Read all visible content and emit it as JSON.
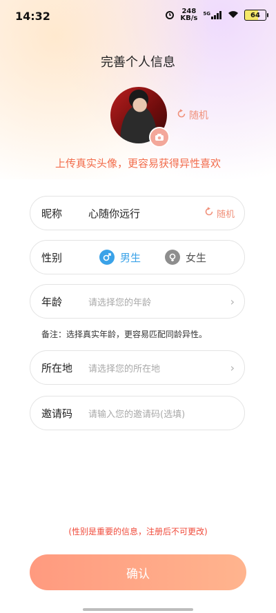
{
  "status_bar": {
    "time": "14:32",
    "net_speed_value": "248",
    "net_speed_unit": "KB/s",
    "network": "5G",
    "battery": "64"
  },
  "page": {
    "title": "完善个人信息",
    "random_label": "随机",
    "upload_tip": "上传真实头像，更容易获得异性喜欢"
  },
  "form": {
    "nickname": {
      "label": "昵称",
      "value": "心随你远行",
      "random_label": "随机"
    },
    "gender": {
      "label": "性别",
      "male": "男生",
      "female": "女生",
      "selected": "male"
    },
    "age": {
      "label": "年龄",
      "placeholder": "请选择您的年龄"
    },
    "age_note": "备注：选择真实年龄，更容易匹配同龄异性。",
    "location": {
      "label": "所在地",
      "placeholder": "请选择您的所在地"
    },
    "invite_code": {
      "label": "邀请码",
      "placeholder": "请输入您的邀请码(选填)"
    }
  },
  "footer": {
    "gender_note": "(性别是重要的信息，注册后不可更改)",
    "confirm_label": "确认"
  },
  "colors": {
    "accent": "#f0907a",
    "male_blue": "#3aa2e8",
    "warning_red": "#f04a3a"
  }
}
